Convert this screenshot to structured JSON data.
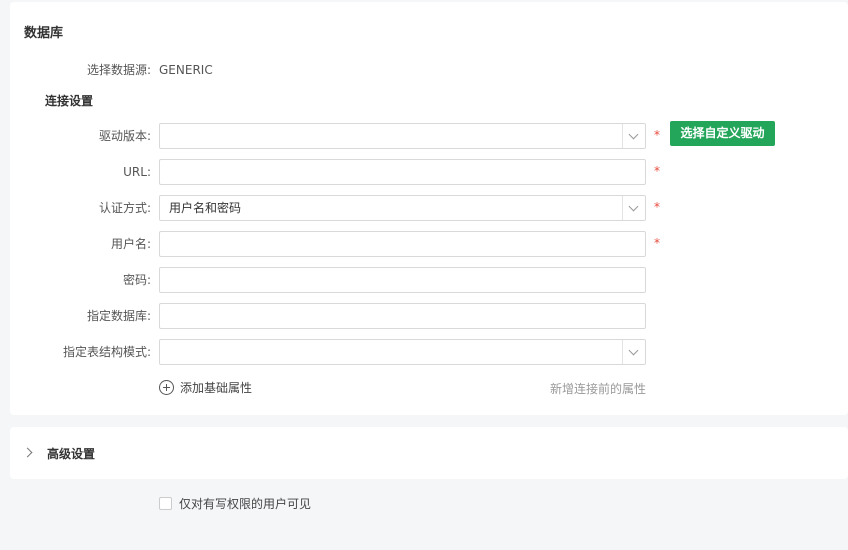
{
  "database": {
    "title": "数据库",
    "source_label": "选择数据源:",
    "source_value": "GENERIC",
    "connection_heading": "连接设置",
    "driver": {
      "label": "驱动版本:",
      "value": "",
      "required": "*"
    },
    "custom_driver_button": "选择自定义驱动",
    "url": {
      "label": "URL:",
      "value": "",
      "required": "*"
    },
    "auth": {
      "label": "认证方式:",
      "value": "用户名和密码",
      "required": "*"
    },
    "username": {
      "label": "用户名:",
      "value": "",
      "required": "*"
    },
    "password": {
      "label": "密码:",
      "value": ""
    },
    "specified_db": {
      "label": "指定数据库:",
      "value": ""
    },
    "schema": {
      "label": "指定表结构模式:",
      "value": ""
    },
    "add_attribute": "添加基础属性",
    "hint": "新增连接前的属性"
  },
  "advanced": {
    "title": "高级设置"
  },
  "visibility": {
    "label": "仅对有写权限的用户可见",
    "checked": false
  },
  "colors": {
    "accent": "#23a55a",
    "required": "#e84c3d"
  }
}
